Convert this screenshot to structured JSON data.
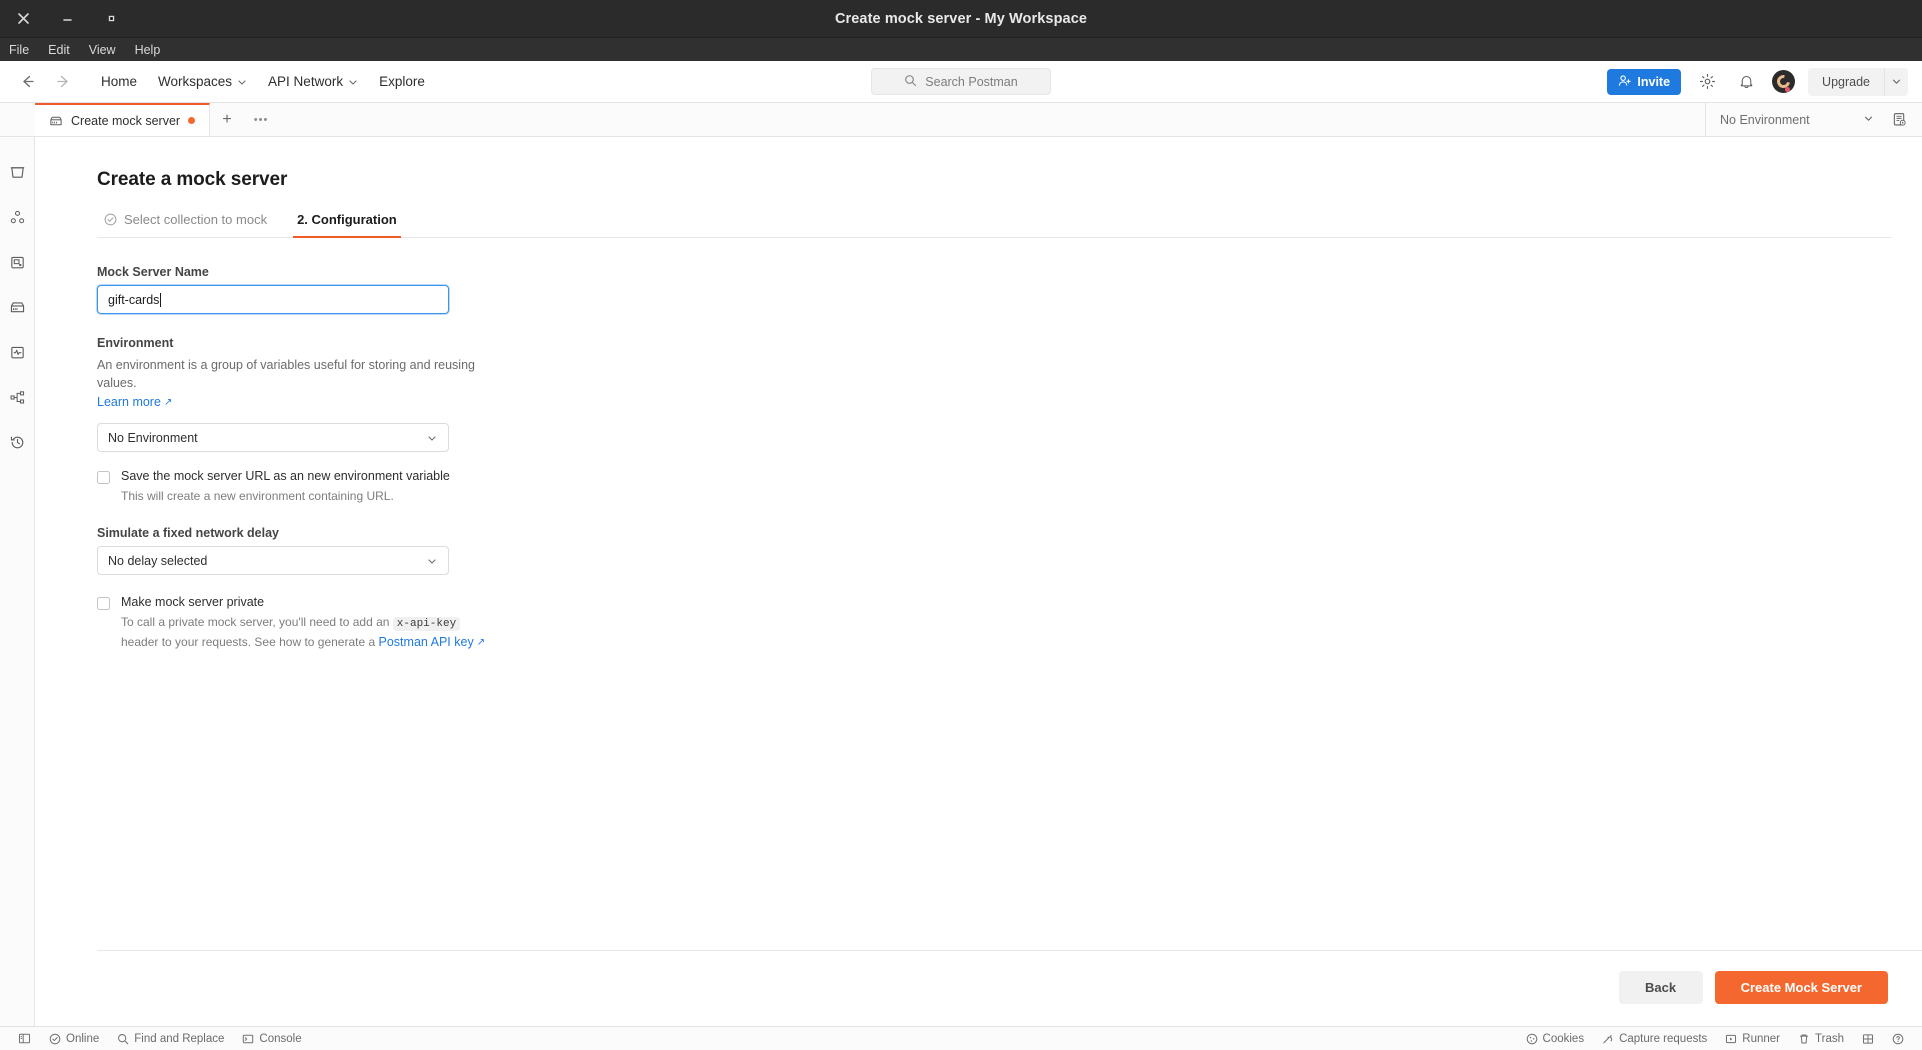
{
  "window": {
    "title": "Create mock server - My Workspace",
    "controls": {
      "close": "close-icon",
      "minimize": "minimize-icon",
      "maximize": "maximize-icon"
    }
  },
  "menubar": {
    "items": [
      "File",
      "Edit",
      "View",
      "Help"
    ]
  },
  "topnav": {
    "back_arrow": "arrow-left-icon",
    "forward_arrow": "arrow-right-icon",
    "links": [
      {
        "label": "Home",
        "has_caret": false
      },
      {
        "label": "Workspaces",
        "has_caret": true
      },
      {
        "label": "API Network",
        "has_caret": true
      },
      {
        "label": "Explore",
        "has_caret": false
      }
    ],
    "search": {
      "placeholder": "Search Postman",
      "icon": "search-icon"
    },
    "invite_label": "Invite",
    "settings_icon": "gear-icon",
    "notifications_icon": "bell-icon",
    "avatar": "user-avatar",
    "upgrade_label": "Upgrade"
  },
  "tabstrip": {
    "tabs": [
      {
        "label": "Create mock server",
        "icon": "mock-server-icon",
        "unsaved": true,
        "active": true
      }
    ],
    "add_tab_label": "+",
    "more_tabs_label": "•••",
    "environment_selector": "No Environment",
    "env_quicklook_icon": "environment-quick-look-icon"
  },
  "sidebar": {
    "items": [
      {
        "name": "collections",
        "icon": "collections-icon"
      },
      {
        "name": "apis",
        "icon": "apis-icon"
      },
      {
        "name": "environments",
        "icon": "environments-icon"
      },
      {
        "name": "mock-servers",
        "icon": "mock-server-icon"
      },
      {
        "name": "monitors",
        "icon": "monitors-icon"
      },
      {
        "name": "flows",
        "icon": "flows-icon"
      },
      {
        "name": "history",
        "icon": "history-icon"
      }
    ]
  },
  "main": {
    "page_title": "Create a mock server",
    "steps": [
      {
        "label": "Select collection to mock",
        "completed": true,
        "active": false
      },
      {
        "label": "2. Configuration",
        "completed": false,
        "active": true
      }
    ],
    "form": {
      "name_label": "Mock Server Name",
      "name_value": "gift-cards",
      "name_placeholder": "Mock Server Name",
      "environment_label": "Environment",
      "environment_desc": "An environment is a group of variables useful for storing and reusing values.",
      "learn_more": "Learn more",
      "environment_value": "No Environment",
      "save_url_checkbox_label": "Save the mock server URL as an new environment variable",
      "save_url_checkbox_sub": "This will create a new environment containing URL.",
      "save_url_checked": false,
      "delay_label": "Simulate a fixed network delay",
      "delay_value": "No delay selected",
      "private_checkbox_label": "Make mock server private",
      "private_checked": false,
      "private_sub_1": "To call a private mock server, you'll need to add an",
      "private_code": "x-api-key",
      "private_sub_2": "header to your requests. See how to generate a",
      "private_link": "Postman API key"
    },
    "footer": {
      "back_label": "Back",
      "create_label": "Create Mock Server"
    }
  },
  "statusbar": {
    "left": [
      {
        "label": "",
        "icon": "sidebar-toggle-icon"
      },
      {
        "label": "Online",
        "icon": "online-icon"
      },
      {
        "label": "Find and Replace",
        "icon": "search-icon"
      },
      {
        "label": "Console",
        "icon": "console-icon"
      }
    ],
    "right": [
      {
        "label": "Cookies",
        "icon": "cookie-icon"
      },
      {
        "label": "Capture requests",
        "icon": "capture-icon"
      },
      {
        "label": "Runner",
        "icon": "runner-icon"
      },
      {
        "label": "Trash",
        "icon": "trash-icon"
      },
      {
        "label": "",
        "icon": "layout-icon"
      },
      {
        "label": "",
        "icon": "help-icon"
      }
    ]
  },
  "colors": {
    "accent_orange": "#F4682F",
    "link_blue": "#1F7AE0",
    "invite_blue": "#1F7AE0",
    "focus_blue": "#3B95F0",
    "titlebar": "#2B2B2B"
  }
}
